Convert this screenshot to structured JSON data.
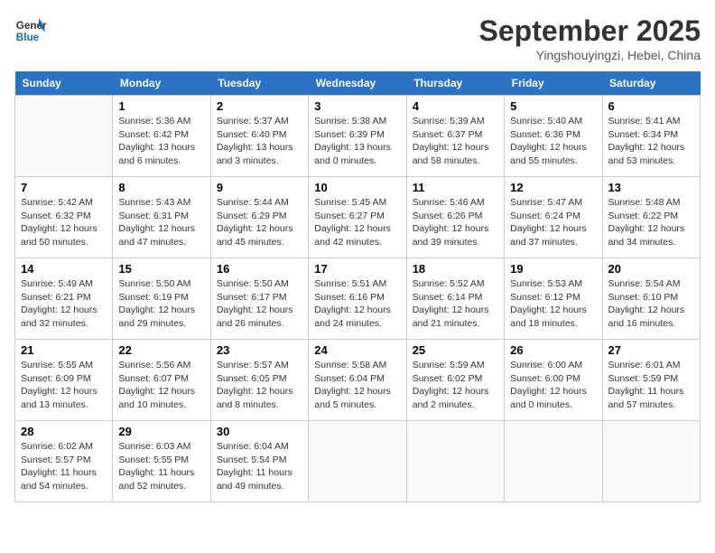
{
  "header": {
    "logo": {
      "line1": "General",
      "line2": "Blue"
    },
    "title": "September 2025",
    "subtitle": "Yingshouyingzi, Hebei, China"
  },
  "days": [
    "Sunday",
    "Monday",
    "Tuesday",
    "Wednesday",
    "Thursday",
    "Friday",
    "Saturday"
  ],
  "weeks": [
    [
      {
        "date": "",
        "sunrise": "",
        "sunset": "",
        "daylight": ""
      },
      {
        "date": "1",
        "sunrise": "Sunrise: 5:36 AM",
        "sunset": "Sunset: 6:42 PM",
        "daylight": "Daylight: 13 hours and 6 minutes."
      },
      {
        "date": "2",
        "sunrise": "Sunrise: 5:37 AM",
        "sunset": "Sunset: 6:40 PM",
        "daylight": "Daylight: 13 hours and 3 minutes."
      },
      {
        "date": "3",
        "sunrise": "Sunrise: 5:38 AM",
        "sunset": "Sunset: 6:39 PM",
        "daylight": "Daylight: 13 hours and 0 minutes."
      },
      {
        "date": "4",
        "sunrise": "Sunrise: 5:39 AM",
        "sunset": "Sunset: 6:37 PM",
        "daylight": "Daylight: 12 hours and 58 minutes."
      },
      {
        "date": "5",
        "sunrise": "Sunrise: 5:40 AM",
        "sunset": "Sunset: 6:36 PM",
        "daylight": "Daylight: 12 hours and 55 minutes."
      },
      {
        "date": "6",
        "sunrise": "Sunrise: 5:41 AM",
        "sunset": "Sunset: 6:34 PM",
        "daylight": "Daylight: 12 hours and 53 minutes."
      }
    ],
    [
      {
        "date": "7",
        "sunrise": "Sunrise: 5:42 AM",
        "sunset": "Sunset: 6:32 PM",
        "daylight": "Daylight: 12 hours and 50 minutes."
      },
      {
        "date": "8",
        "sunrise": "Sunrise: 5:43 AM",
        "sunset": "Sunset: 6:31 PM",
        "daylight": "Daylight: 12 hours and 47 minutes."
      },
      {
        "date": "9",
        "sunrise": "Sunrise: 5:44 AM",
        "sunset": "Sunset: 6:29 PM",
        "daylight": "Daylight: 12 hours and 45 minutes."
      },
      {
        "date": "10",
        "sunrise": "Sunrise: 5:45 AM",
        "sunset": "Sunset: 6:27 PM",
        "daylight": "Daylight: 12 hours and 42 minutes."
      },
      {
        "date": "11",
        "sunrise": "Sunrise: 5:46 AM",
        "sunset": "Sunset: 6:26 PM",
        "daylight": "Daylight: 12 hours and 39 minutes."
      },
      {
        "date": "12",
        "sunrise": "Sunrise: 5:47 AM",
        "sunset": "Sunset: 6:24 PM",
        "daylight": "Daylight: 12 hours and 37 minutes."
      },
      {
        "date": "13",
        "sunrise": "Sunrise: 5:48 AM",
        "sunset": "Sunset: 6:22 PM",
        "daylight": "Daylight: 12 hours and 34 minutes."
      }
    ],
    [
      {
        "date": "14",
        "sunrise": "Sunrise: 5:49 AM",
        "sunset": "Sunset: 6:21 PM",
        "daylight": "Daylight: 12 hours and 32 minutes."
      },
      {
        "date": "15",
        "sunrise": "Sunrise: 5:50 AM",
        "sunset": "Sunset: 6:19 PM",
        "daylight": "Daylight: 12 hours and 29 minutes."
      },
      {
        "date": "16",
        "sunrise": "Sunrise: 5:50 AM",
        "sunset": "Sunset: 6:17 PM",
        "daylight": "Daylight: 12 hours and 26 minutes."
      },
      {
        "date": "17",
        "sunrise": "Sunrise: 5:51 AM",
        "sunset": "Sunset: 6:16 PM",
        "daylight": "Daylight: 12 hours and 24 minutes."
      },
      {
        "date": "18",
        "sunrise": "Sunrise: 5:52 AM",
        "sunset": "Sunset: 6:14 PM",
        "daylight": "Daylight: 12 hours and 21 minutes."
      },
      {
        "date": "19",
        "sunrise": "Sunrise: 5:53 AM",
        "sunset": "Sunset: 6:12 PM",
        "daylight": "Daylight: 12 hours and 18 minutes."
      },
      {
        "date": "20",
        "sunrise": "Sunrise: 5:54 AM",
        "sunset": "Sunset: 6:10 PM",
        "daylight": "Daylight: 12 hours and 16 minutes."
      }
    ],
    [
      {
        "date": "21",
        "sunrise": "Sunrise: 5:55 AM",
        "sunset": "Sunset: 6:09 PM",
        "daylight": "Daylight: 12 hours and 13 minutes."
      },
      {
        "date": "22",
        "sunrise": "Sunrise: 5:56 AM",
        "sunset": "Sunset: 6:07 PM",
        "daylight": "Daylight: 12 hours and 10 minutes."
      },
      {
        "date": "23",
        "sunrise": "Sunrise: 5:57 AM",
        "sunset": "Sunset: 6:05 PM",
        "daylight": "Daylight: 12 hours and 8 minutes."
      },
      {
        "date": "24",
        "sunrise": "Sunrise: 5:58 AM",
        "sunset": "Sunset: 6:04 PM",
        "daylight": "Daylight: 12 hours and 5 minutes."
      },
      {
        "date": "25",
        "sunrise": "Sunrise: 5:59 AM",
        "sunset": "Sunset: 6:02 PM",
        "daylight": "Daylight: 12 hours and 2 minutes."
      },
      {
        "date": "26",
        "sunrise": "Sunrise: 6:00 AM",
        "sunset": "Sunset: 6:00 PM",
        "daylight": "Daylight: 12 hours and 0 minutes."
      },
      {
        "date": "27",
        "sunrise": "Sunrise: 6:01 AM",
        "sunset": "Sunset: 5:59 PM",
        "daylight": "Daylight: 11 hours and 57 minutes."
      }
    ],
    [
      {
        "date": "28",
        "sunrise": "Sunrise: 6:02 AM",
        "sunset": "Sunset: 5:57 PM",
        "daylight": "Daylight: 11 hours and 54 minutes."
      },
      {
        "date": "29",
        "sunrise": "Sunrise: 6:03 AM",
        "sunset": "Sunset: 5:55 PM",
        "daylight": "Daylight: 11 hours and 52 minutes."
      },
      {
        "date": "30",
        "sunrise": "Sunrise: 6:04 AM",
        "sunset": "Sunset: 5:54 PM",
        "daylight": "Daylight: 11 hours and 49 minutes."
      },
      {
        "date": "",
        "sunrise": "",
        "sunset": "",
        "daylight": ""
      },
      {
        "date": "",
        "sunrise": "",
        "sunset": "",
        "daylight": ""
      },
      {
        "date": "",
        "sunrise": "",
        "sunset": "",
        "daylight": ""
      },
      {
        "date": "",
        "sunrise": "",
        "sunset": "",
        "daylight": ""
      }
    ]
  ]
}
